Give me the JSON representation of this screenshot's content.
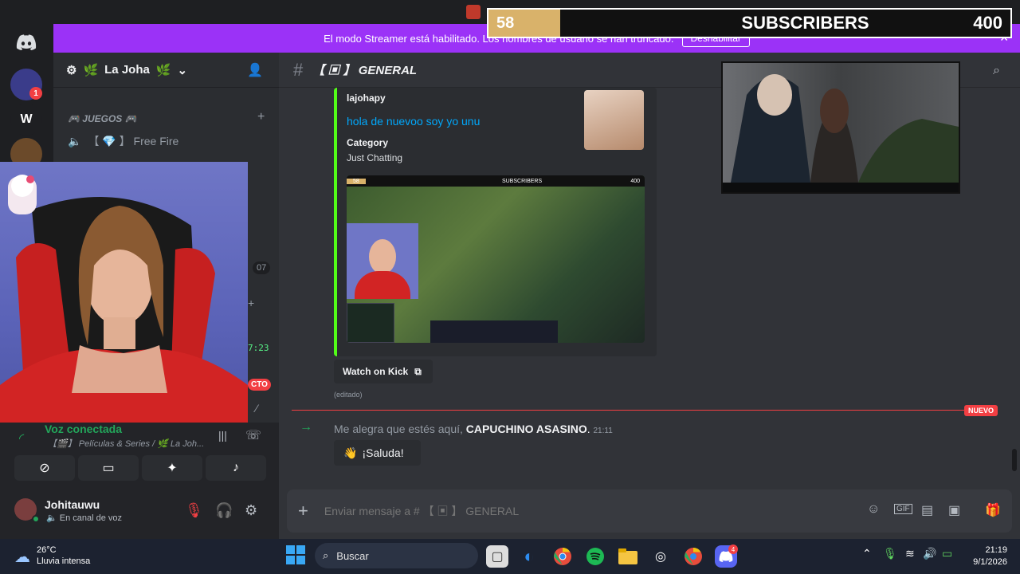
{
  "colors": {
    "banner": "#9b32f7",
    "kick_green": "#53fc18",
    "accent": "#5865f2",
    "danger": "#f23f43",
    "sub_gold": "#d9b26a"
  },
  "subscriber_overlay": {
    "count": "58",
    "label": "SUBSCRIBERS",
    "goal": "400"
  },
  "banner": {
    "text": "El modo Streamer está habilitado. Los nombres de usuario se han truncado.",
    "button": "Deshabilitar"
  },
  "rail": {
    "home_icon": "discord-logo-icon",
    "badge": "1",
    "server_w": "W"
  },
  "server": {
    "name": "La Joha"
  },
  "sidebar": {
    "category": "JUEGOS",
    "channels": [
      {
        "label": "【 💎 】 Free Fire"
      }
    ],
    "partial_labels": {
      "p1": "07",
      "p2": "7:23",
      "p3": "CTO"
    }
  },
  "voice": {
    "status": "Voz conectada",
    "channel": "【🎬】 Películas & Series / 🌿 La Joh...",
    "user": {
      "name": "Johitauwu",
      "status": "En canal de voz"
    }
  },
  "chat": {
    "channel_name": "【 ▣ 】 GENERAL",
    "embed": {
      "author": "lajohapy",
      "title": "hola de nuevoo soy yo unu",
      "field_name": "Category",
      "field_value": "Just Chatting",
      "thumb_sub_label": "SUBSCRIBERS",
      "thumb_sub_goal": "400",
      "thumb_sub_count": "58"
    },
    "watch_button": "Watch on Kick",
    "edited": "(editado)",
    "new_label": "NUEVO",
    "system_message": {
      "prefix": "Me alegra que estés aquí,",
      "user": "CAPUCHINO ASASINO",
      "time": "21:11"
    },
    "wave_button": "¡Saluda!",
    "composer_placeholder": "Enviar mensaje a # 【 ▣ 】 GENERAL"
  },
  "taskbar": {
    "weather_temp": "26°C",
    "weather_desc": "Lluvia intensa",
    "search": "Buscar",
    "time": "21:19",
    "date": "9/1/2026",
    "discord_badge": "4"
  }
}
